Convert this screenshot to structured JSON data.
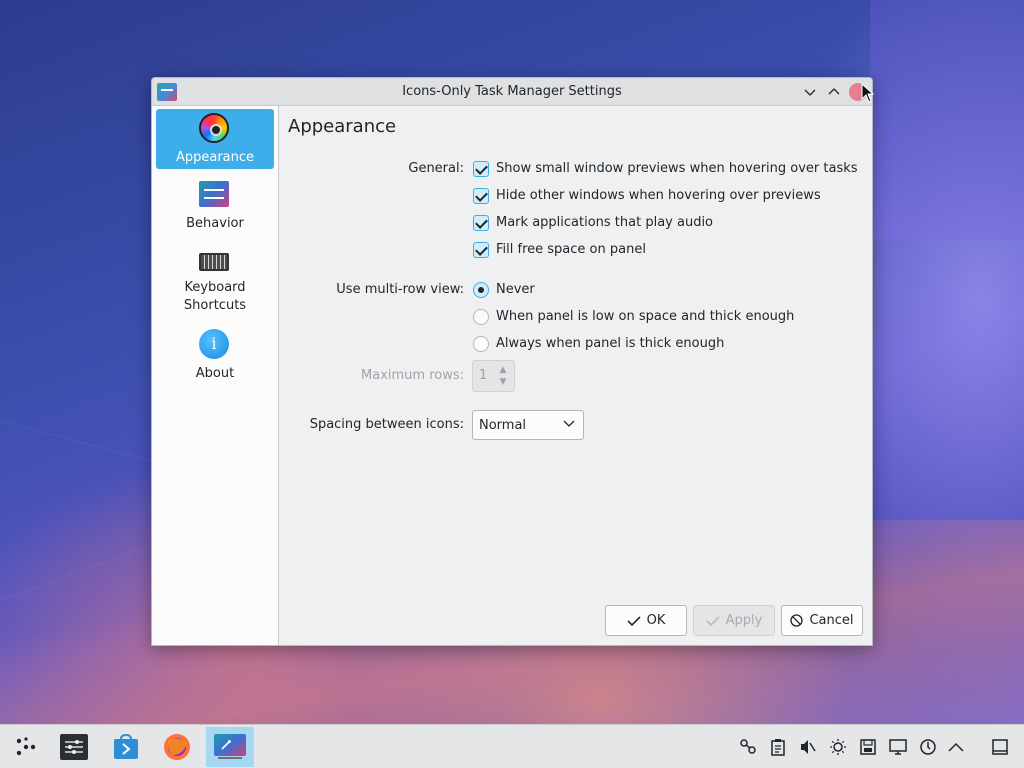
{
  "window": {
    "title": "Icons-Only Task Manager Settings",
    "accent": "#3daee9"
  },
  "sidebar": {
    "items": [
      {
        "label": "Appearance",
        "icon": "color-wheel-icon",
        "active": true
      },
      {
        "label": "Behavior",
        "icon": "sliders-icon",
        "active": false
      },
      {
        "label": "Keyboard Shortcuts",
        "icon": "keyboard-icon",
        "active": false
      },
      {
        "label": "About",
        "icon": "info-icon",
        "active": false
      }
    ]
  },
  "page": {
    "title": "Appearance",
    "general": {
      "label": "General:",
      "options": [
        {
          "label": "Show small window previews when hovering over tasks",
          "checked": true
        },
        {
          "label": "Hide other windows when hovering over previews",
          "checked": true
        },
        {
          "label": "Mark applications that play audio",
          "checked": true
        },
        {
          "label": "Fill free space on panel",
          "checked": true
        }
      ]
    },
    "multirow": {
      "label": "Use multi-row view:",
      "options": [
        {
          "label": "Never",
          "selected": true
        },
        {
          "label": "When panel is low on space and thick enough",
          "selected": false
        },
        {
          "label": "Always when panel is thick enough",
          "selected": false
        }
      ]
    },
    "max_rows": {
      "label": "Maximum rows:",
      "value": "1",
      "enabled": false
    },
    "spacing": {
      "label": "Spacing between icons:",
      "value": "Normal"
    }
  },
  "buttons": {
    "ok": "OK",
    "apply": "Apply",
    "cancel": "Cancel"
  },
  "taskbar": {
    "launcher_icon": "application-launcher-icon",
    "tasks": [
      "system-settings-icon",
      "discover-store-icon",
      "firefox-icon",
      "task-manager-settings-icon"
    ],
    "tray": [
      "network-icon",
      "clipboard-icon",
      "volume-muted-icon",
      "brightness-icon",
      "disks-icon",
      "display-icon",
      "power-icon",
      "show-hidden-icon",
      "show-desktop-icon"
    ]
  }
}
